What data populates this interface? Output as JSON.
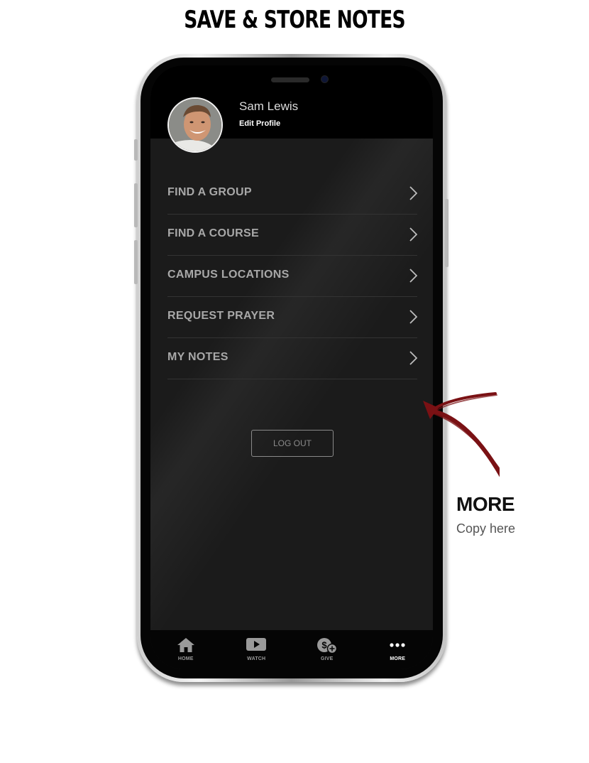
{
  "page": {
    "title": "SAVE & STORE NOTES"
  },
  "profile": {
    "name": "Sam Lewis",
    "edit_label": "Edit Profile"
  },
  "menu": {
    "items": [
      {
        "label": "FIND A GROUP",
        "icon": "chevron-right-icon"
      },
      {
        "label": "FIND A COURSE",
        "icon": "chevron-right-icon"
      },
      {
        "label": "CAMPUS LOCATIONS",
        "icon": "chevron-right-icon"
      },
      {
        "label": "REQUEST PRAYER",
        "icon": "chevron-right-icon"
      },
      {
        "label": "MY NOTES",
        "icon": "chevron-right-icon"
      }
    ]
  },
  "logout": {
    "label": "LOG OUT"
  },
  "tabs": [
    {
      "label": "HOME",
      "icon": "home-icon",
      "active": false
    },
    {
      "label": "WATCH",
      "icon": "play-icon",
      "active": false
    },
    {
      "label": "GIVE",
      "icon": "give-icon",
      "active": false
    },
    {
      "label": "MORE",
      "icon": "more-dots-icon",
      "active": true
    }
  ],
  "callout": {
    "title": "MORE",
    "copy": "Copy here"
  },
  "colors": {
    "arrow": "#7a1114",
    "screen_bg": "#1b1b1b",
    "menu_text": "#a8a8a8"
  }
}
